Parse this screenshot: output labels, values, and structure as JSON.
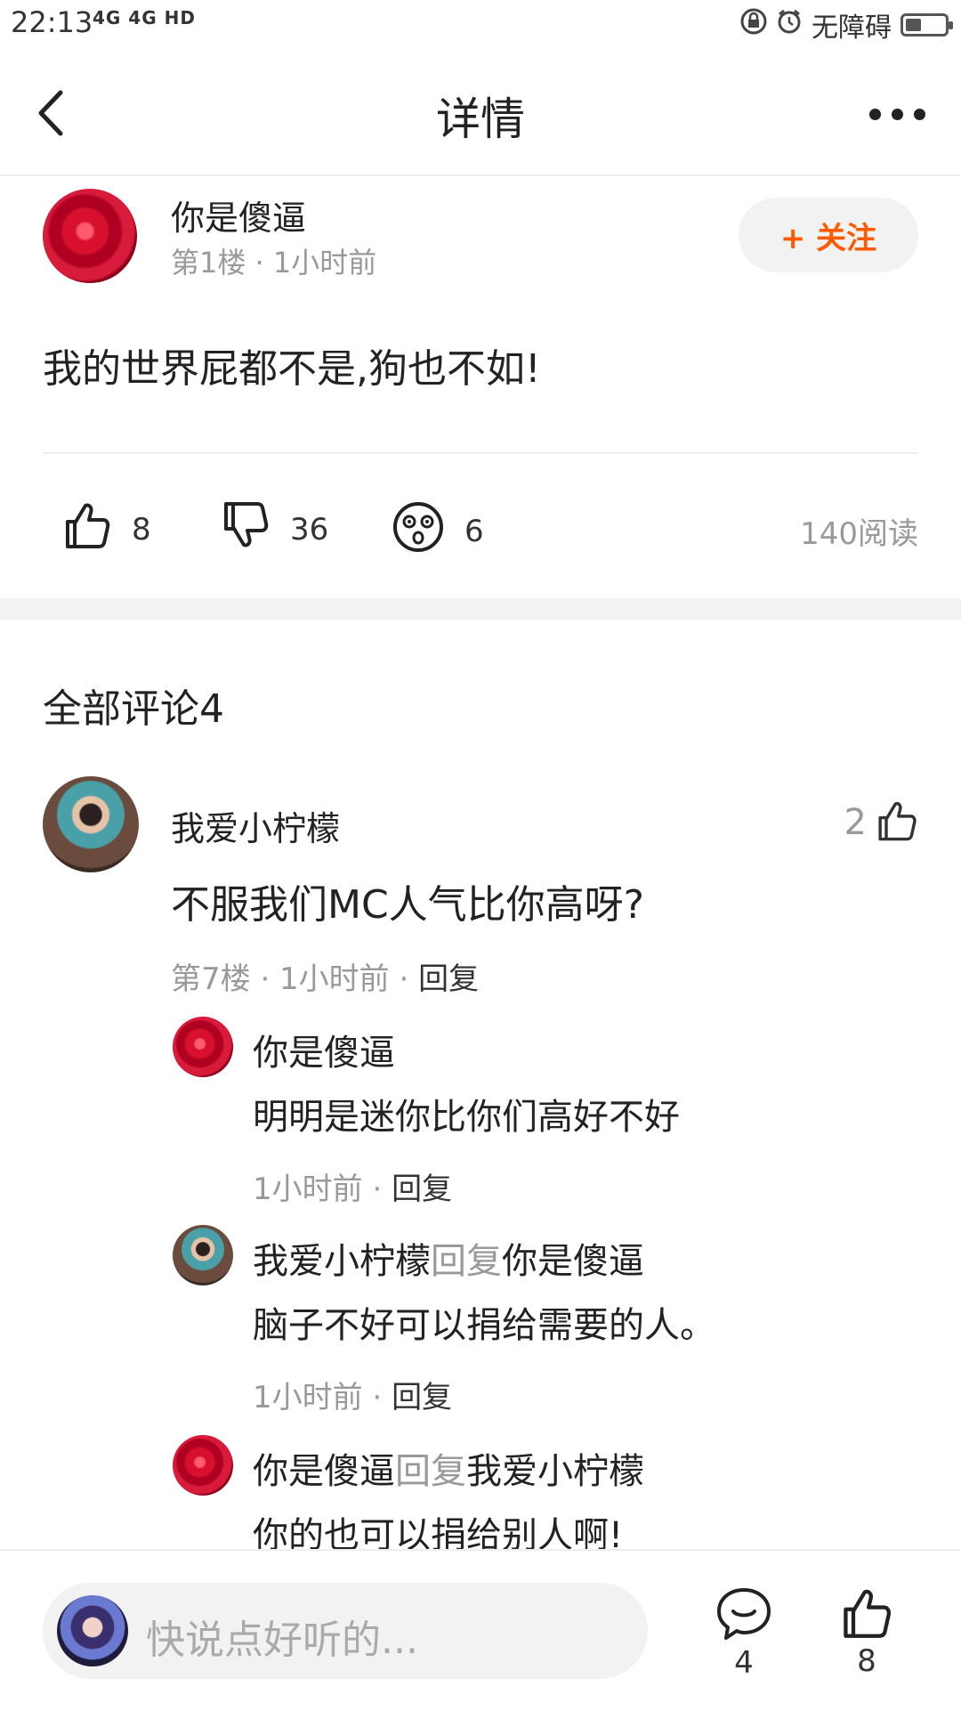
{
  "status_bar": {
    "time": "22:13",
    "signal": "4G 4G HD",
    "accessibility": "无障碍"
  },
  "nav": {
    "title": "详情"
  },
  "post": {
    "author": "你是傻逼",
    "floor_time": "第1楼 · 1小时前",
    "follow_label": "+ 关注",
    "content": "我的世界屁都不是,狗也不如!",
    "likes": "8",
    "dislikes": "36",
    "emoji_count": "6",
    "reads": "140阅读"
  },
  "comments_header": "全部评论4",
  "comment": {
    "author": "我爱小柠檬",
    "like_count": "2",
    "text": "不服我们MC人气比你高呀?",
    "meta": "第7楼 · 1小时前 · ",
    "reply_label": "回复",
    "replies": [
      {
        "author": "你是傻逼",
        "reply_word": "",
        "target": "",
        "text": "明明是迷你比你们高好不好",
        "meta": "1小时前 · ",
        "reply_label": "回复"
      },
      {
        "author": "我爱小柠檬",
        "reply_word": "回复",
        "target": "你是傻逼",
        "text": "脑子不好可以捐给需要的人。",
        "meta": "1小时前 · ",
        "reply_label": "回复"
      },
      {
        "author": "你是傻逼",
        "reply_word": "回复",
        "target": "我爱小柠檬",
        "text": "你的也可以捐给别人啊!"
      }
    ]
  },
  "bottom_bar": {
    "input_placeholder": "快说点好听的...",
    "comment_count": "4",
    "like_count": "8"
  },
  "colors": {
    "accent": "#ff5a00",
    "muted": "#999999"
  }
}
